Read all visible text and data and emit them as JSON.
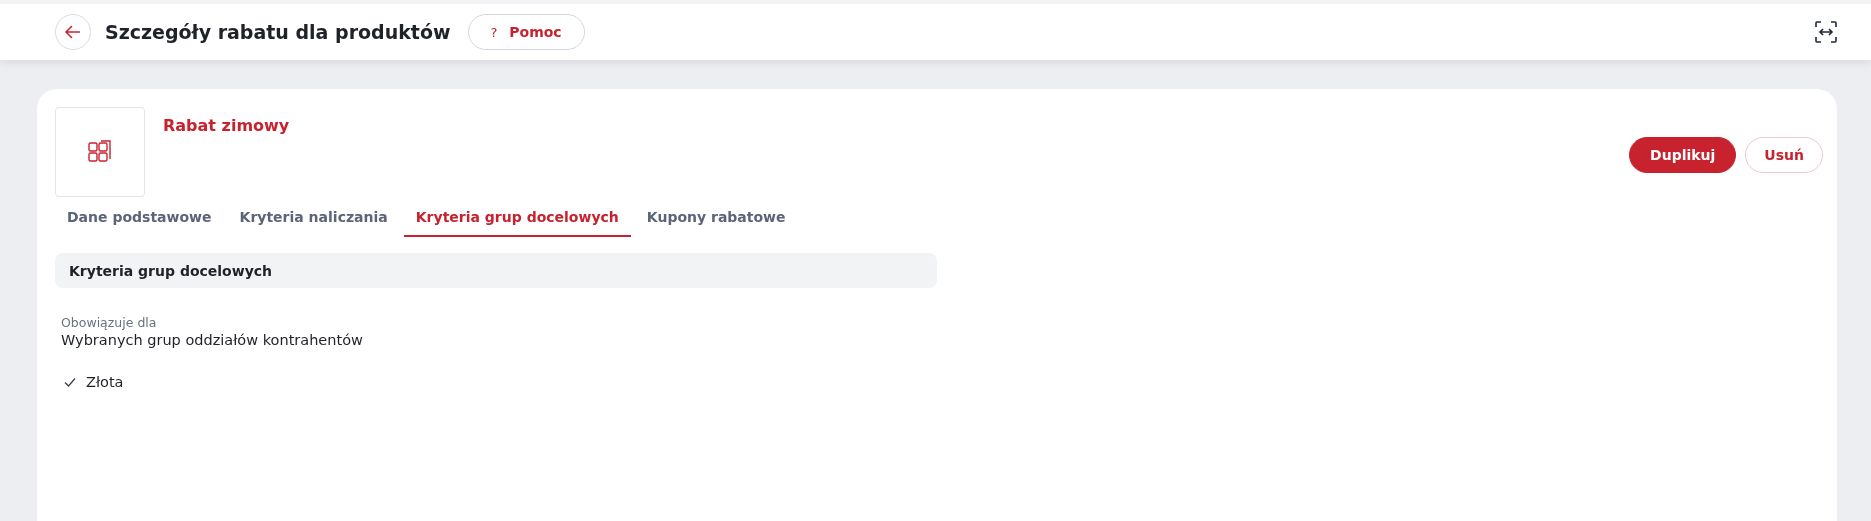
{
  "header": {
    "title": "Szczegóły rabatu dla produktów",
    "help_button": {
      "icon_text": "?",
      "label": "Pomoc"
    }
  },
  "discount": {
    "name": "Rabat zimowy"
  },
  "actions": [
    {
      "label": "Duplikuj",
      "kind": "primary"
    },
    {
      "label": "Usuń",
      "kind": "secondary"
    }
  ],
  "tabs": [
    {
      "label": "Dane podstawowe",
      "selected": false
    },
    {
      "label": "Kryteria naliczania",
      "selected": false
    },
    {
      "label": "Kryteria grup docelowych",
      "selected": true
    },
    {
      "label": "Kupony rabatowe",
      "selected": false
    }
  ],
  "section": {
    "title": "Kryteria grup docelowych",
    "field": {
      "label": "Obowiązuje dla",
      "value": "Wybranych grup oddziałów kontrahentów"
    },
    "groups": [
      {
        "label": "Złota",
        "checked": true
      }
    ]
  }
}
